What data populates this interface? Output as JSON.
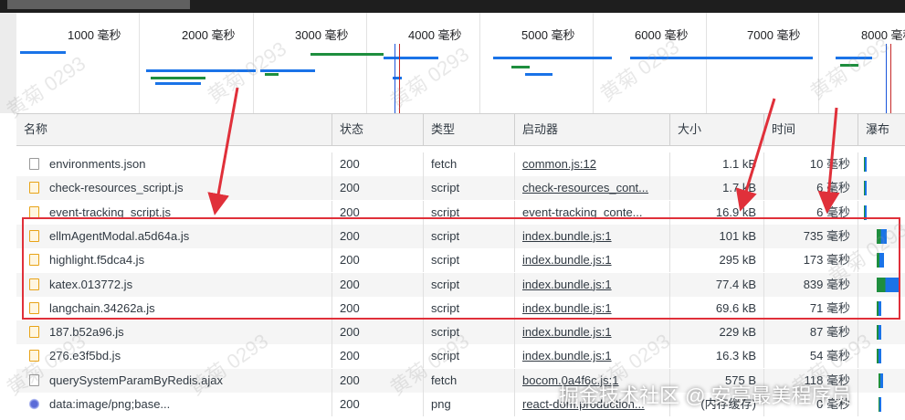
{
  "colors": {
    "accent": "#e0303a",
    "waterfall_blue": "#1a73e8",
    "waterfall_green": "#1e8e3e",
    "watermark": "#969696"
  },
  "overview": {
    "ticks": [
      "1000 毫秒",
      "2000 毫秒",
      "3000 毫秒",
      "4000 毫秒",
      "5000 毫秒",
      "6000 毫秒",
      "7000 毫秒",
      "8000 毫秒"
    ]
  },
  "columns": {
    "name": "名称",
    "status": "状态",
    "type": "类型",
    "initiator": "启动器",
    "size": "大小",
    "time": "时间",
    "waterfall": "瀑布"
  },
  "rows": [
    {
      "name": "environments.json",
      "icon": "doc-icon",
      "status": "200",
      "type": "fetch",
      "initiator": "common.js:12",
      "size": "1.1 kB",
      "time": "10 毫秒",
      "wf_start": 0.0,
      "wf_len": 0.02
    },
    {
      "name": "check-resources_script.js",
      "icon": "js-icon",
      "status": "200",
      "type": "script",
      "initiator": "check-resources_cont...",
      "size": "1.7 kB",
      "time": "6 毫秒",
      "wf_start": 0.0,
      "wf_len": 0.02
    },
    {
      "name": "event-tracking_script.js",
      "icon": "js-icon",
      "status": "200",
      "type": "script",
      "initiator": "event-tracking_conte...",
      "size": "16.9 kB",
      "time": "6 毫秒",
      "wf_start": 0.0,
      "wf_len": 0.02
    },
    {
      "name": "ellmAgentModal.a5d64a.js",
      "icon": "js-icon",
      "status": "200",
      "type": "script",
      "initiator": "index.bundle.js:1",
      "size": "101 kB",
      "time": "735 毫秒",
      "wf_start": 0.55,
      "wf_len": 0.2
    },
    {
      "name": "highlight.f5dca4.js",
      "icon": "js-icon",
      "status": "200",
      "type": "script",
      "initiator": "index.bundle.js:1",
      "size": "295 kB",
      "time": "173 毫秒",
      "wf_start": 0.55,
      "wf_len": 0.15
    },
    {
      "name": "katex.013772.js",
      "icon": "js-icon",
      "status": "200",
      "type": "script",
      "initiator": "index.bundle.js:1",
      "size": "77.4 kB",
      "time": "839 毫秒",
      "wf_start": 0.55,
      "wf_len": 0.45
    },
    {
      "name": "langchain.34262a.js",
      "icon": "js-icon",
      "status": "200",
      "type": "script",
      "initiator": "index.bundle.js:1",
      "size": "69.6 kB",
      "time": "71 毫秒",
      "wf_start": 0.55,
      "wf_len": 0.1
    },
    {
      "name": "187.b52a96.js",
      "icon": "js-icon",
      "status": "200",
      "type": "script",
      "initiator": "index.bundle.js:1",
      "size": "229 kB",
      "time": "87 毫秒",
      "wf_start": 0.55,
      "wf_len": 0.1
    },
    {
      "name": "276.e3f5bd.js",
      "icon": "js-icon",
      "status": "200",
      "type": "script",
      "initiator": "index.bundle.js:1",
      "size": "16.3 kB",
      "time": "54 毫秒",
      "wf_start": 0.55,
      "wf_len": 0.1
    },
    {
      "name": "querySystemParamByRedis.ajax",
      "icon": "doc-icon",
      "status": "200",
      "type": "fetch",
      "initiator": "bocom.0a4f6c.js:1",
      "size": "575 B",
      "time": "118 毫秒",
      "wf_start": 0.6,
      "wf_len": 0.1
    },
    {
      "name": "data:image/png;base...",
      "icon": "image-icon",
      "status": "200",
      "type": "png",
      "initiator": "react-dom.production...",
      "size": "(内存缓存)",
      "time": "0 毫秒",
      "wf_start": 0.6,
      "wf_len": 0.05
    }
  ],
  "watermark_text": "黄菊 0293",
  "footer_watermark": "掘金技术社区 @ 安亭最美程序员"
}
